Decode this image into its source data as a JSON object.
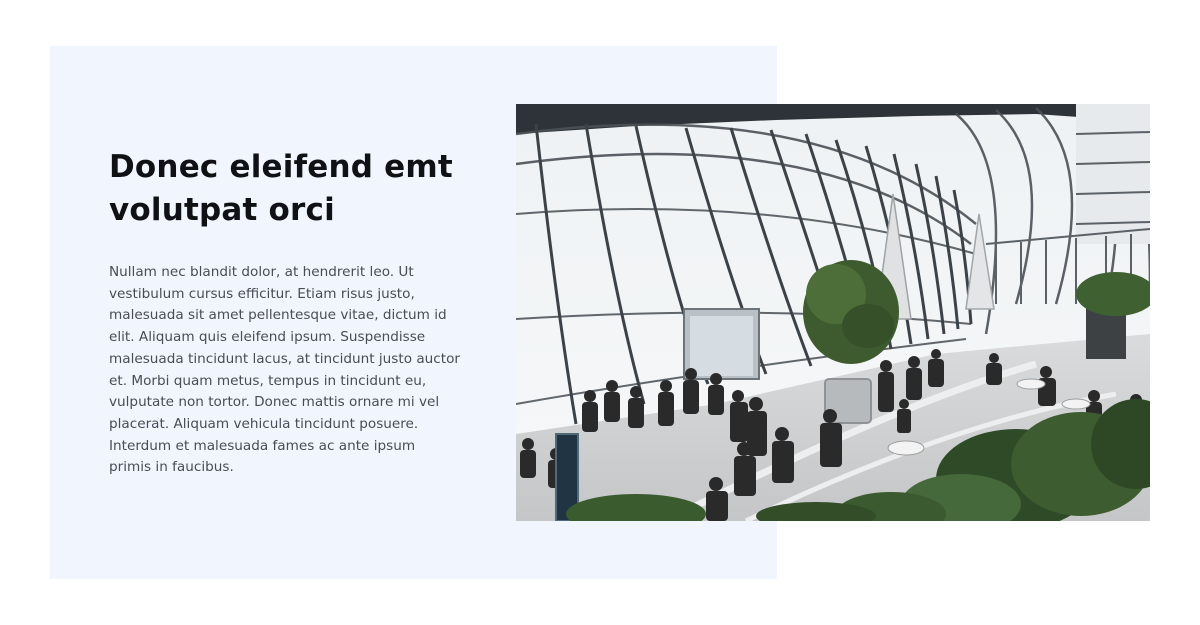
{
  "section": {
    "heading": "Donec eleifend emt volutpat orci",
    "body": "Nullam nec blandit dolor, at hendrerit leo. Ut vestibulum cursus efficitur. Etiam risus justo, malesuada sit amet pellentesque vitae, dictum id elit. Aliquam quis eleifend ipsum. Suspendisse malesuada tincidunt lacus, at tincidunt justo auctor et. Morbi quam metus, tempus in tincidunt eu, vulputate non tortor. Donec mattis ornare mi vel placerat. Aliquam vehicula tincidunt posuere. Interdum et malesuada fames ac ante ipsum primis in faucibus."
  },
  "colors": {
    "panel_background": "#f1f6fe",
    "heading": "#0f1115",
    "body_text": "#4a4c53"
  }
}
